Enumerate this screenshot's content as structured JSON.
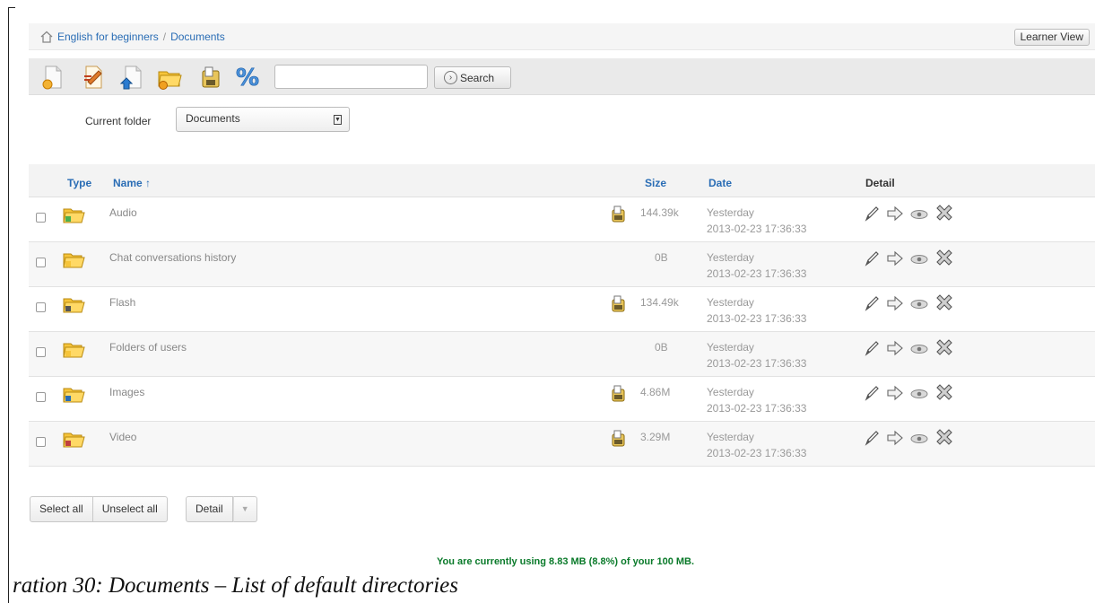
{
  "breadcrumb": {
    "course": "English for beginners",
    "separator": "/",
    "section": "Documents"
  },
  "header": {
    "learner_view": "Learner View"
  },
  "toolbar": {
    "icons": [
      "new-document-icon",
      "create-draw-icon",
      "upload-icon",
      "new-folder-icon",
      "download-all-icon",
      "quota-icon"
    ],
    "search_value": "",
    "search_label": "Search"
  },
  "folder": {
    "label": "Current folder",
    "selected": "Documents"
  },
  "table": {
    "headers": {
      "type": "Type",
      "name": "Name ↑",
      "size": "Size",
      "date": "Date",
      "detail": "Detail"
    },
    "rows": [
      {
        "name": "Audio",
        "size": "144.39k",
        "date_rel": "Yesterday",
        "date_abs": "2013-02-23 17:36:33",
        "icon": "audio-folder-icon",
        "downloadable": true
      },
      {
        "name": "Chat conversations history",
        "size": "0B",
        "date_rel": "Yesterday",
        "date_abs": "2013-02-23 17:36:33",
        "icon": "chat-folder-icon",
        "downloadable": false
      },
      {
        "name": "Flash",
        "size": "134.49k",
        "date_rel": "Yesterday",
        "date_abs": "2013-02-23 17:36:33",
        "icon": "flash-folder-icon",
        "downloadable": true
      },
      {
        "name": "Folders of users",
        "size": "0B",
        "date_rel": "Yesterday",
        "date_abs": "2013-02-23 17:36:33",
        "icon": "users-folder-icon",
        "downloadable": false
      },
      {
        "name": "Images",
        "size": "4.86M",
        "date_rel": "Yesterday",
        "date_abs": "2013-02-23 17:36:33",
        "icon": "images-folder-icon",
        "downloadable": true
      },
      {
        "name": "Video",
        "size": "3.29M",
        "date_rel": "Yesterday",
        "date_abs": "2013-02-23 17:36:33",
        "icon": "video-folder-icon",
        "downloadable": true
      }
    ]
  },
  "actions": {
    "select_all": "Select all",
    "unselect_all": "Unselect all",
    "detail": "Detail",
    "caret": "▼"
  },
  "quota": {
    "text": "You are currently using 8.83 MB (8.8%) of your 100 MB."
  },
  "caption": {
    "text": "ration 30: Documents – List of default directories"
  }
}
